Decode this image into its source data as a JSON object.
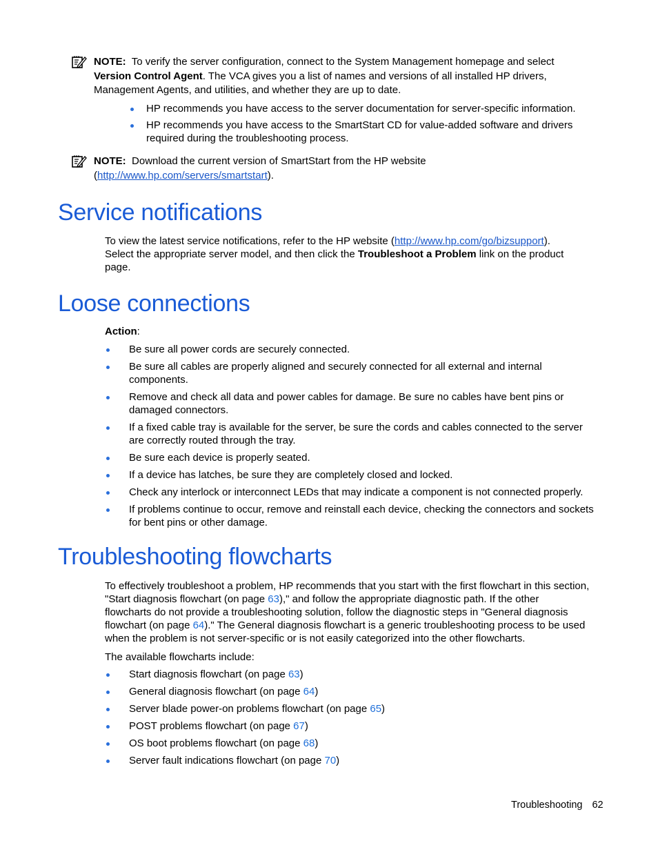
{
  "note1": {
    "icon": "note-pencil-icon",
    "label": "NOTE:",
    "line1": "To verify the server configuration, connect to the System Management homepage and select",
    "bold": "Version Control Agent",
    "line2_rest": ". The VCA gives you a list of names and versions of all installed HP drivers,",
    "line3": "Management Agents, and utilities, and whether they are up to date.",
    "bullets": [
      {
        "lines": [
          "HP recommends you have access to the server documentation for server-specific information."
        ]
      },
      {
        "lines": [
          "HP recommends you have access to the SmartStart CD for value-added software and drivers",
          "required during the troubleshooting process."
        ]
      }
    ]
  },
  "note2": {
    "icon": "note-pencil-icon",
    "label": "NOTE:",
    "line1": "Download the current version of SmartStart from the HP website",
    "open_paren": "(",
    "link": "http://www.hp.com/servers/smartstart",
    "close": ")."
  },
  "service": {
    "heading": "Service notifications",
    "p1_pre": "To view the latest service notifications, refer to the HP website (",
    "p1_link": "http://www.hp.com/go/bizsupport",
    "p1_post": ").",
    "p2_pre": "Select the appropriate server model, and then click the ",
    "p2_bold": "Troubleshoot a Problem",
    "p2_post": " link on the product",
    "p3": "page."
  },
  "loose": {
    "heading": "Loose connections",
    "action_label": "Action",
    "action_colon": ":",
    "bullets": [
      {
        "lines": [
          "Be sure all power cords are securely connected."
        ]
      },
      {
        "lines": [
          "Be sure all cables are properly aligned and securely connected for all external and internal",
          "components."
        ]
      },
      {
        "lines": [
          "Remove and check all data and power cables for damage. Be sure no cables have bent pins or",
          "damaged connectors."
        ]
      },
      {
        "lines": [
          "If a fixed cable tray is available for the server, be sure the cords and cables connected to the server",
          "are correctly routed through the tray."
        ]
      },
      {
        "lines": [
          "Be sure each device is properly seated."
        ]
      },
      {
        "lines": [
          "If a device has latches, be sure they are completely closed and locked."
        ]
      },
      {
        "lines": [
          "Check any interlock or interconnect LEDs that may indicate a component is not connected properly."
        ]
      },
      {
        "lines": [
          "If problems continue to occur, remove and reinstall each device, checking the connectors and sockets",
          "for bent pins or other damage."
        ]
      }
    ]
  },
  "flow": {
    "heading": "Troubleshooting flowcharts",
    "p_l1": "To effectively troubleshoot a problem, HP recommends that you start with the first flowchart in this section,",
    "p_l2_pre": "\"Start diagnosis flowchart (on page ",
    "p_l2_page": "63",
    "p_l2_post": "),\" and follow the appropriate diagnostic path. If the other",
    "p_l3": "flowcharts do not provide a troubleshooting solution, follow the diagnostic steps in \"General diagnosis",
    "p_l4_pre": "flowchart (on page ",
    "p_l4_page": "64",
    "p_l4_post": ").\" The General diagnosis flowchart is a generic troubleshooting process to be used",
    "p_l5": "when the problem is not server-specific or is not easily categorized into the other flowcharts.",
    "available": "The available flowcharts include:",
    "items": [
      {
        "text": "Start diagnosis flowchart (on page ",
        "page": "63",
        "close": ")"
      },
      {
        "text": "General diagnosis flowchart (on page ",
        "page": "64",
        "close": ")"
      },
      {
        "text": "Server blade power-on problems flowchart (on page ",
        "page": "65",
        "close": ")"
      },
      {
        "text": "POST problems flowchart (on page ",
        "page": "67",
        "close": ")"
      },
      {
        "text": "OS boot problems flowchart (on page ",
        "page": "68",
        "close": ")"
      },
      {
        "text": "Server fault indications flowchart (on page ",
        "page": "70",
        "close": ")"
      }
    ]
  },
  "footer": {
    "section": "Troubleshooting",
    "page_number": "62"
  }
}
